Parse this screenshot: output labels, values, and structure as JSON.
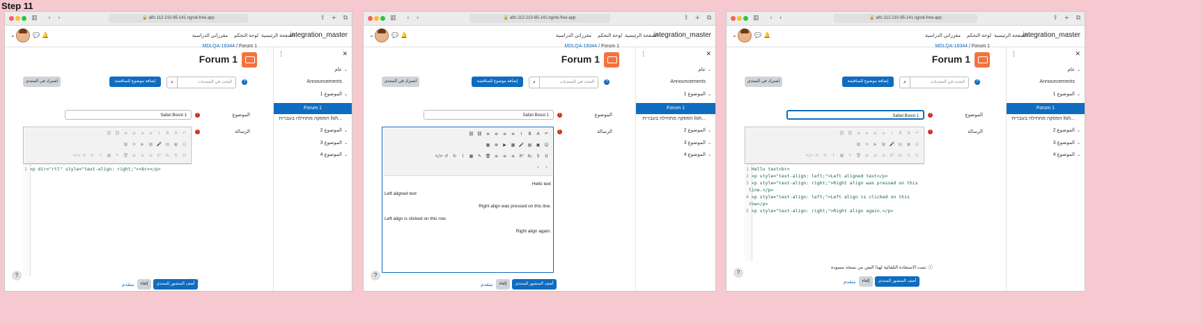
{
  "step_label": "Step 11",
  "colors": {
    "primary": "#0f6cbf",
    "forum_icon": "#f4733b",
    "required": "#ca3120",
    "background": "#f5c9cf"
  },
  "windows": [
    {
      "url": "alfc-112-210-85-141.ngrok-free.app",
      "site_name": "integration_master",
      "nav": {
        "home": "الصفحة الرئيسية",
        "dashboard": "لوحة التحكم",
        "mycourses": "مقرراتي الدراسية"
      },
      "drawer": {
        "items": [
          {
            "label": "عام",
            "type": "section"
          },
          {
            "label": "Announcements",
            "type": "item"
          },
          {
            "label": "الموضوع 1",
            "type": "section"
          },
          {
            "label": "Forum 1",
            "type": "active"
          },
          {
            "label": "הפסקה מתחילה בעברית lish...",
            "type": "item"
          },
          {
            "label": "الموضوع 2",
            "type": "section"
          },
          {
            "label": "الموضوع 3",
            "type": "section"
          },
          {
            "label": "الموضوع 4",
            "type": "section"
          }
        ]
      },
      "breadcrumb": {
        "forum": "Forum 1",
        "sep": "/",
        "course": "MDLQA-18344"
      },
      "forum_title": "Forum 1",
      "search_placeholder": "البحث في المنتديات",
      "add_topic": "إضافة موضوع للمناقشة",
      "subscribe": "اشترك في المنتدى",
      "subject_label": "الموضوع",
      "message_label": "الرسالة",
      "subject_value": "Safari Boost 1",
      "code_lines": [
        {
          "n": "1",
          "text": "<p dir=\"rtl\" style=\"text-align: right;\"><br></p>"
        }
      ],
      "required_note": "مطلوب",
      "post_button": "أضف المنشور للمنتدى",
      "cancel_button": "إلغاء",
      "advanced_link": "متقدم",
      "help": "?"
    },
    {
      "url": "alfc-112-210-85-141.ngrok-free.app",
      "site_name": "integration_master",
      "nav": {
        "home": "الصفحة الرئيسية",
        "dashboard": "لوحة التحكم",
        "mycourses": "مقرراتي الدراسية"
      },
      "drawer": {
        "items": [
          {
            "label": "عام",
            "type": "section"
          },
          {
            "label": "Announcements",
            "type": "item"
          },
          {
            "label": "الموضوع 1",
            "type": "section"
          },
          {
            "label": "Forum 1",
            "type": "active"
          },
          {
            "label": "הפסקה מתחילה בעברית lish...",
            "type": "item"
          },
          {
            "label": "الموضوع 2",
            "type": "section"
          },
          {
            "label": "الموضوع 3",
            "type": "section"
          },
          {
            "label": "الموضوع 4",
            "type": "section"
          }
        ]
      },
      "breadcrumb": {
        "forum": "Forum 1",
        "sep": "/",
        "course": "MDLQA-18344"
      },
      "forum_title": "Forum 1",
      "search_placeholder": "البحث في المنتديات",
      "add_topic": "إضافة موضوع للمناقشة",
      "subscribe": "اشترك في المنتدى",
      "subject_label": "الموضوع",
      "message_label": "الرسالة",
      "subject_value": "Safari Boost 1",
      "wysiwyg_lines": [
        {
          "text": "Hello text",
          "align": "right"
        },
        {
          "text": "Left aligned text",
          "align": "left"
        },
        {
          "text": "Right align was pressed on this line.",
          "align": "right"
        },
        {
          "text": "Left align is clicked on this row",
          "align": "left"
        },
        {
          "text": "Right align again.",
          "align": "right"
        }
      ],
      "post_button": "أضف المنشور للمنتدى",
      "cancel_button": "إلغاء",
      "advanced_link": "متقدم",
      "help": "?"
    },
    {
      "url": "alfc-112-210-85-141.ngrok-free.app",
      "site_name": "integration_master",
      "nav": {
        "home": "الصفحة الرئيسية",
        "dashboard": "لوحة التحكم",
        "mycourses": "مقرراتي الدراسية"
      },
      "drawer": {
        "items": [
          {
            "label": "عام",
            "type": "section"
          },
          {
            "label": "Announcements",
            "type": "item"
          },
          {
            "label": "الموضوع 1",
            "type": "section"
          },
          {
            "label": "Forum 1",
            "type": "active"
          },
          {
            "label": "הפסקה מתחילה בעברית lish...",
            "type": "item"
          },
          {
            "label": "الموضوع 2",
            "type": "section"
          },
          {
            "label": "الموضوع 3",
            "type": "section"
          },
          {
            "label": "الموضوع 4",
            "type": "section"
          }
        ]
      },
      "breadcrumb": {
        "forum": "Forum 1",
        "sep": "/",
        "course": "MDLQA-18344"
      },
      "forum_title": "Forum 1",
      "search_placeholder": "البحث في المنتديات",
      "add_topic": "إضافة موضوع للمناقشة",
      "subscribe": "اشترك في المنتدى",
      "subject_label": "الموضوع",
      "message_label": "الرسالة",
      "subject_value": "Safari Boost 1",
      "code_lines": [
        {
          "n": "1",
          "text": "Hello text<br>"
        },
        {
          "n": "2",
          "text": "<p style=\"text-align: left;\">Left aligned text</p>"
        },
        {
          "n": "3",
          "text": "<p style=\"text-align: right;\">Right align was pressed on this"
        },
        {
          "n": "",
          "text": "line.</p>"
        },
        {
          "n": "4",
          "text": "<p style=\"text-align: left;\">Left align is clicked on this"
        },
        {
          "n": "",
          "text": "row</p>"
        },
        {
          "n": "5",
          "text": "<p style=\"text-align: right;\">Right align again.</p>"
        }
      ],
      "autosave_note": "تمت الاستعادة التلقائية لهذا النص من نسخة مسودة.",
      "post_button": "أضف المنشور للمنتدى",
      "cancel_button": "إلغاء",
      "advanced_link": "متقدم",
      "help": "?"
    }
  ]
}
